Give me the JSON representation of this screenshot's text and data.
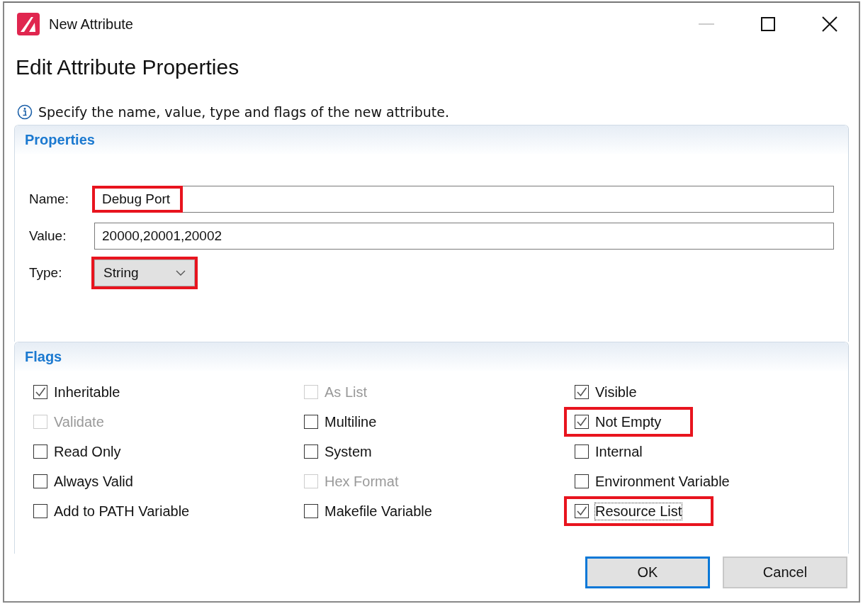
{
  "window": {
    "title": "New Attribute"
  },
  "heading": "Edit Attribute Properties",
  "info": "Specify the name, value, type and flags of the new attribute.",
  "properties": {
    "title": "Properties",
    "fields": [
      {
        "kind": "text",
        "label": "Name:",
        "value": "Debug Port",
        "highlighted": true
      },
      {
        "kind": "text",
        "label": "Value:",
        "value": "20000,20001,20002",
        "highlighted": false
      },
      {
        "kind": "combo",
        "label": "Type:",
        "value": "String",
        "highlighted": true
      }
    ]
  },
  "flags": {
    "title": "Flags",
    "columns": [
      [
        {
          "label": "Inheritable",
          "checked": true,
          "disabled": false,
          "highlighted": false,
          "focused": false
        },
        {
          "label": "Validate",
          "checked": false,
          "disabled": true,
          "highlighted": false,
          "focused": false
        },
        {
          "label": "Read Only",
          "checked": false,
          "disabled": false,
          "highlighted": false,
          "focused": false
        },
        {
          "label": "Always Valid",
          "checked": false,
          "disabled": false,
          "highlighted": false,
          "focused": false
        },
        {
          "label": "Add to PATH Variable",
          "checked": false,
          "disabled": false,
          "highlighted": false,
          "focused": false
        }
      ],
      [
        {
          "label": "As List",
          "checked": false,
          "disabled": true,
          "highlighted": false,
          "focused": false
        },
        {
          "label": "Multiline",
          "checked": false,
          "disabled": false,
          "highlighted": false,
          "focused": false
        },
        {
          "label": "System",
          "checked": false,
          "disabled": false,
          "highlighted": false,
          "focused": false
        },
        {
          "label": "Hex Format",
          "checked": false,
          "disabled": true,
          "highlighted": false,
          "focused": false
        },
        {
          "label": "Makefile Variable",
          "checked": false,
          "disabled": false,
          "highlighted": false,
          "focused": false
        }
      ],
      [
        {
          "label": "Visible",
          "checked": true,
          "disabled": false,
          "highlighted": false,
          "focused": false
        },
        {
          "label": "Not Empty",
          "checked": true,
          "disabled": false,
          "highlighted": true,
          "focused": false
        },
        {
          "label": "Internal",
          "checked": false,
          "disabled": false,
          "highlighted": false,
          "focused": false
        },
        {
          "label": "Environment Variable",
          "checked": false,
          "disabled": false,
          "highlighted": false,
          "focused": false
        },
        {
          "label": "Resource List",
          "checked": true,
          "disabled": false,
          "highlighted": true,
          "focused": true
        }
      ]
    ]
  },
  "buttons": [
    {
      "label": "OK",
      "default": true
    },
    {
      "label": "Cancel",
      "default": false
    }
  ]
}
